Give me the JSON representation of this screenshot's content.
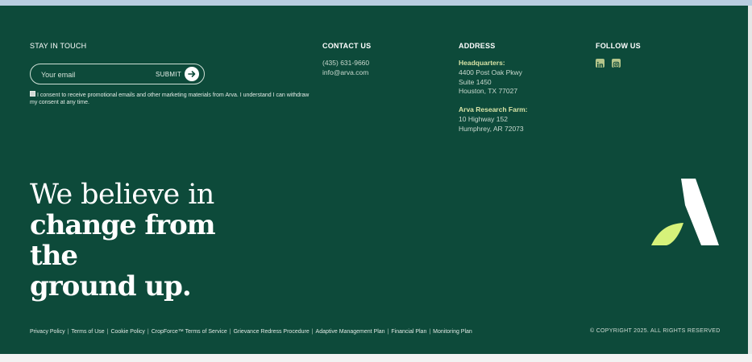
{
  "stay_in_touch": {
    "heading": "STAY IN TOUCH",
    "email_placeholder": "Your email",
    "submit_label": "SUBMIT",
    "consent_text": "I consent to receive promotional emails and other marketing materials from Arva. I understand I can withdraw my consent at any time."
  },
  "contact": {
    "heading": "CONTACT US",
    "phone": "(435) 631-9660",
    "email": "info@arva.com"
  },
  "address": {
    "heading": "ADDRESS",
    "hq_label": "Headquarters:",
    "hq_line1": "4400 Post Oak Pkwy",
    "hq_line2": "Suite 1450",
    "hq_line3": "Houston, TX 77027",
    "farm_label": "Arva Research Farm:",
    "farm_line1": "10 Highway 152",
    "farm_line2": "Humphrey, AR 72073"
  },
  "follow": {
    "heading": "FOLLOW US",
    "icons": [
      "linkedin-icon",
      "instagram-icon"
    ]
  },
  "tagline": {
    "line1": "We believe in",
    "line2": "change from",
    "line3": "the",
    "line4": "ground up."
  },
  "legal_links": [
    "Privacy Policy",
    "Terms of Use",
    "Cookie Policy",
    "CropForce™ Terms of Service",
    "Grievance Redress Procedure",
    "Adaptive Management Plan",
    "Financial Plan",
    "Monitoring Plan"
  ],
  "copyright": "© COPYRIGHT 2025. ALL RIGHTS RESERVED",
  "colors": {
    "background": "#0d4a3a",
    "accent": "#d6f27a",
    "text": "#ffffff"
  }
}
